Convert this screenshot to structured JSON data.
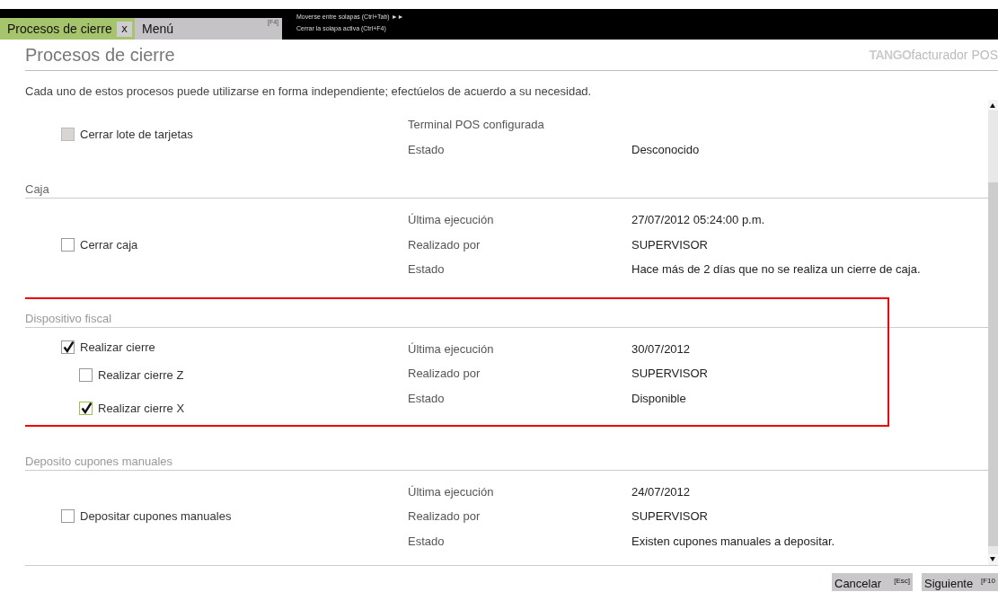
{
  "tabs": [
    {
      "label": "Procesos de cierre",
      "selected": true,
      "close": "x"
    },
    {
      "label": "Menú",
      "selected": false,
      "shortcut": "[F4]"
    }
  ],
  "hints": [
    "Moverse entre solapas (Ctrl+Tab) ►►",
    "Cerrar la solapa activa (Ctrl+F4)"
  ],
  "page": {
    "title": "Procesos de cierre",
    "logo_brand": "TANGO",
    "logo_product": "facturador POS",
    "description": "Cada uno de estos procesos puede utilizarse en forma independiente; efectúelos de acuerdo a su necesidad."
  },
  "sections": [
    {
      "highlighted": false,
      "options": [
        {
          "label": "Cerrar lote de tarjetas",
          "checked": false,
          "disabled": true,
          "focused": false
        }
      ],
      "info": [
        {
          "label": "Terminal POS configurada"
        },
        {
          "label": "Estado",
          "value": "Desconocido"
        }
      ]
    },
    {
      "title": "Caja",
      "highlighted": false,
      "options": [
        {
          "label": "Cerrar caja",
          "checked": false,
          "disabled": false,
          "focused": false
        }
      ],
      "info": [
        {
          "label": "Última ejecución",
          "value": "27/07/2012 05:24:00 p.m."
        },
        {
          "label": "Realizado por",
          "value": "SUPERVISOR"
        },
        {
          "label": "Estado",
          "value": "Hace más de 2 días que no se realiza un cierre de caja."
        }
      ]
    },
    {
      "title": "Dispositivo fiscal",
      "highlighted": true,
      "options": [
        {
          "label": "Realizar cierre",
          "checked": true,
          "disabled": false,
          "focused": false,
          "children": [
            {
              "label": "Realizar cierre Z",
              "checked": false,
              "disabled": false,
              "focused": false
            },
            {
              "label": "Realizar cierre X",
              "checked": true,
              "disabled": false,
              "focused": true
            }
          ]
        }
      ],
      "info": [
        {
          "label": "Última ejecución",
          "value": "30/07/2012"
        },
        {
          "label": "Realizado por",
          "value": "SUPERVISOR"
        },
        {
          "label": "Estado",
          "value": "Disponible"
        }
      ]
    },
    {
      "title": "Deposito cupones manuales",
      "highlighted": false,
      "options": [
        {
          "label": "Depositar cupones manuales",
          "checked": false,
          "disabled": false,
          "focused": false
        }
      ],
      "info": [
        {
          "label": "Última ejecución",
          "value": "24/07/2012"
        },
        {
          "label": "Realizado por",
          "value": "SUPERVISOR"
        },
        {
          "label": "Estado",
          "value": "Existen cupones manuales a depositar."
        }
      ]
    }
  ],
  "buttons": [
    {
      "label": "Cancelar",
      "shortcut": "[Esc]"
    },
    {
      "label": "Siguiente",
      "shortcut": "[F10"
    }
  ]
}
